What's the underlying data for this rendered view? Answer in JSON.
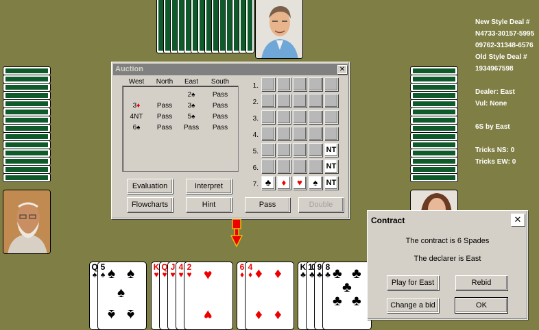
{
  "info": {
    "new_style_label": "New Style Deal #",
    "new_style_line1": "N4733-30157-5995",
    "new_style_line2": "09762-31348-6576",
    "old_style_label": "Old Style Deal #",
    "old_style_value": "1934967598",
    "dealer": "Dealer: East",
    "vul": "Vul: None",
    "contract": "6S by East",
    "tricks_ns": "Tricks NS: 0",
    "tricks_ew": "Tricks EW: 0"
  },
  "auction": {
    "title": "Auction",
    "headers": [
      "West",
      "North",
      "East",
      "South"
    ],
    "rows": [
      [
        "",
        "",
        "2♠",
        "Pass"
      ],
      [
        "3♦",
        "Pass",
        "3♠",
        "Pass"
      ],
      [
        "4NT",
        "Pass",
        "5♠",
        "Pass"
      ],
      [
        "6♠",
        "Pass",
        "Pass",
        "Pass"
      ]
    ],
    "level_labels": [
      "1.",
      "2.",
      "3.",
      "4.",
      "5.",
      "6.",
      "7."
    ],
    "row6_nt": "NT",
    "row7": [
      "♣",
      "♦",
      "♥",
      "♠",
      "NT"
    ],
    "buttons": {
      "evaluation": "Evaluation",
      "interpret": "Interpret",
      "flowcharts": "Flowcharts",
      "hint": "Hint",
      "pass": "Pass",
      "double": "Double"
    }
  },
  "contract_dialog": {
    "title": "Contract",
    "line1": "The contract is 6 Spades",
    "line2": "The declarer is East",
    "buttons": {
      "play_east": "Play for East",
      "rebid": "Rebid",
      "change_bid": "Change a bid",
      "ok": "OK"
    }
  },
  "hand": {
    "spades": [
      "Q",
      "5"
    ],
    "hearts": [
      "K",
      "Q",
      "J",
      "4",
      "2"
    ],
    "diamonds": [
      "6",
      "4"
    ],
    "clubs": [
      "K",
      "10",
      "9",
      "8"
    ]
  },
  "colors": {
    "felt": "#7f7f45",
    "title_active": "#0a246a",
    "title_inactive": "#808080",
    "red": "#ee0000"
  }
}
